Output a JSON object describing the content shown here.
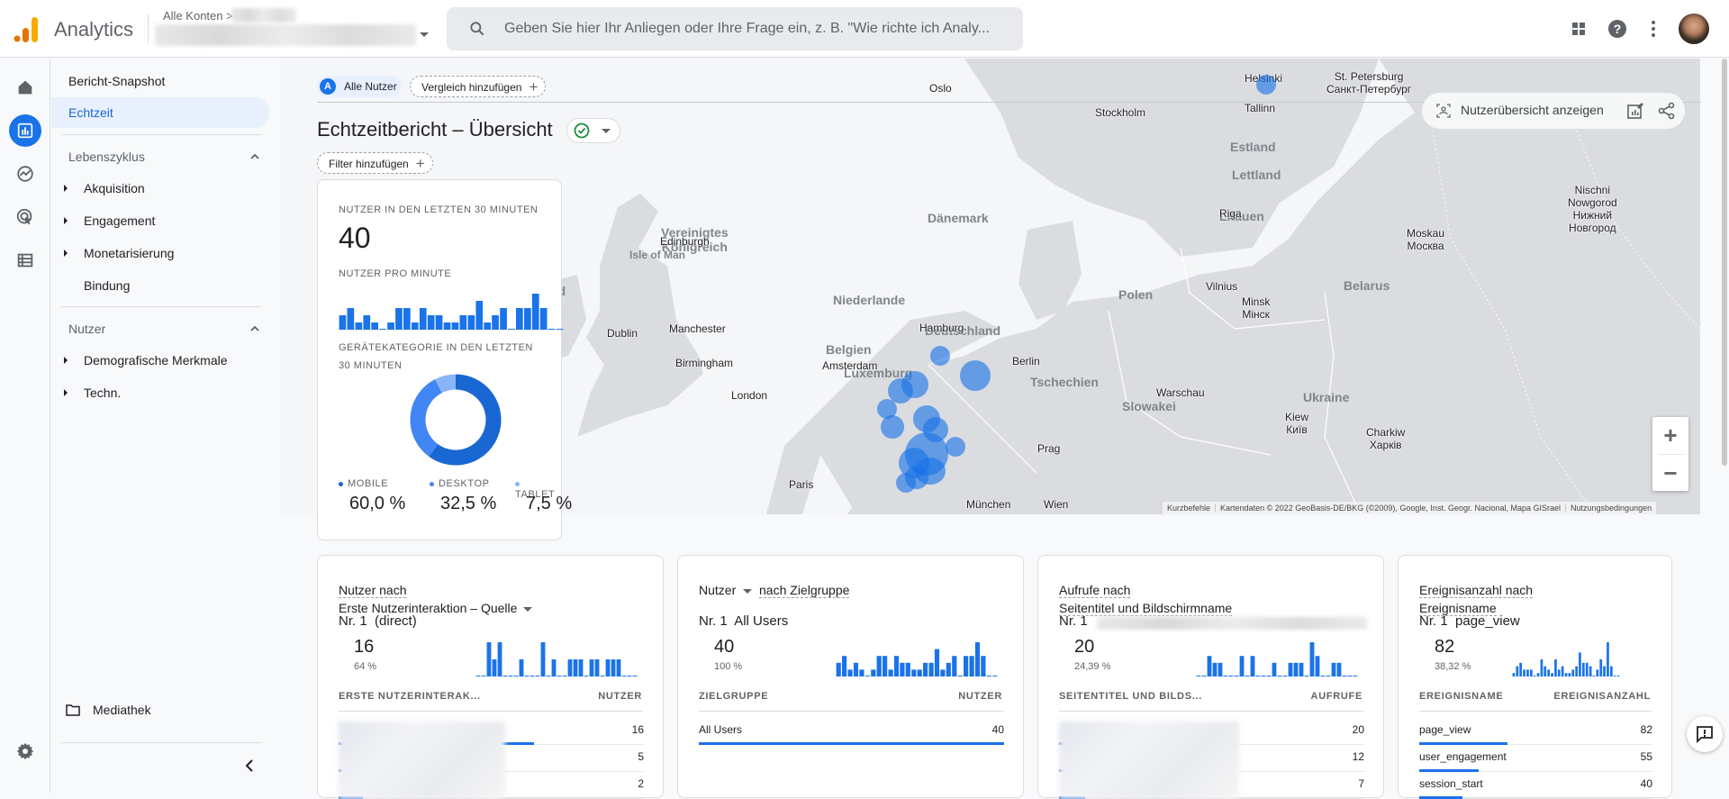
{
  "header": {
    "app_name": "Analytics",
    "account_breadcrumb": "Alle Konten >",
    "search_placeholder": "Geben Sie hier Ihr Anliegen oder Ihre Frage ein, z. B. \"Wie richte ich Analy...",
    "icons": [
      "apps-grid-icon",
      "help-icon",
      "more-vert-icon",
      "avatar"
    ]
  },
  "rail": {
    "items": [
      "home-icon",
      "reports-icon",
      "explore-icon",
      "advertising-icon",
      "configure-icon"
    ],
    "active": "reports-icon",
    "bottom": "settings-gear-icon"
  },
  "nav": {
    "snapshot": "Bericht-Snapshot",
    "realtime": "Echtzeit",
    "section_lifecycle": "Lebenszyklus",
    "lifecycle_items": [
      {
        "label": "Akquisition",
        "expandable": true
      },
      {
        "label": "Engagement",
        "expandable": true
      },
      {
        "label": "Monetarisierung",
        "expandable": true
      },
      {
        "label": "Bindung",
        "expandable": false
      }
    ],
    "section_user": "Nutzer",
    "user_items": [
      {
        "label": "Demografische Merkmale",
        "expandable": true
      },
      {
        "label": "Techn.",
        "expandable": true
      }
    ],
    "library": "Mediathek"
  },
  "toolbar": {
    "segment_badge": "A",
    "segment": "Alle Nutzer",
    "add_comparison": "Vergleich hinzufügen",
    "title": "Echtzeitbericht – Übersicht",
    "add_filter": "Filter hinzufügen",
    "view_user_snapshot": "Nutzerübersicht anzeigen"
  },
  "map": {
    "cities": [
      {
        "name": "Oslo"
      },
      {
        "name": "Stockholm"
      },
      {
        "name": "Helsinki"
      },
      {
        "name": "Tallinn"
      },
      {
        "name": "St. Petersburg\nСанкт-Петербург"
      },
      {
        "name": "Riga"
      },
      {
        "name": "Edinburgh"
      },
      {
        "name": "Dublin"
      },
      {
        "name": "Manchester"
      },
      {
        "name": "Birmingham"
      },
      {
        "name": "London"
      },
      {
        "name": "Amsterdam"
      },
      {
        "name": "Hamburg"
      },
      {
        "name": "Berlin"
      },
      {
        "name": "Paris"
      },
      {
        "name": "Prag"
      },
      {
        "name": "München"
      },
      {
        "name": "Wien"
      },
      {
        "name": "Warschau"
      },
      {
        "name": "Vilnius"
      },
      {
        "name": "Minsk\nМінск"
      },
      {
        "name": "Kiew\nКиїв"
      },
      {
        "name": "Charkiw\nХарків"
      },
      {
        "name": "Moskau\nМосква"
      },
      {
        "name": "Nischni\nNowgorod\nНижний\nНовгород"
      }
    ],
    "countries": [
      "Vereinigtes\nKönigreich",
      "Isle of Man",
      "Irland",
      "Dänemark",
      "Niederlande",
      "Deutschland",
      "Belgien",
      "Luxemburg",
      "Tschechien",
      "Slowakei",
      "Polen",
      "Belarus",
      "Ukraine",
      "Litauen",
      "Lettland",
      "Estland"
    ],
    "zoom_in": "+",
    "zoom_out": "−",
    "attribution": [
      "Kurzbefehle",
      "Kartendaten © 2022 GeoBasis-DE/BKG (©2009), Google, Inst. Geogr. Nacional, Mapa GISrael",
      "Nutzungsbedingungen"
    ]
  },
  "summary": {
    "users_30min_label": "Nutzer in den letzten 30 Minuten",
    "users_30min": "40",
    "per_minute_label": "Nutzer pro Minute",
    "per_minute": [
      2,
      3,
      1,
      2,
      1,
      0,
      1,
      3,
      3,
      1,
      3,
      2,
      2,
      1,
      1,
      2,
      2,
      4,
      1,
      2,
      3,
      0,
      3,
      3,
      5,
      3,
      0,
      0
    ],
    "device_label_1": "Gerätekategorie in den letzten",
    "device_label_2": "30 Minuten",
    "devices": [
      {
        "name": "MOBILE",
        "value": "60,0 %",
        "share": 60.0,
        "color": "#1967d2"
      },
      {
        "name": "DESKTOP",
        "value": "32,5 %",
        "share": 32.5,
        "color": "#4285f4"
      },
      {
        "name": "TABLET",
        "value": "7,5 %",
        "share": 7.5,
        "color": "#8ab4f8"
      }
    ]
  },
  "cards": [
    {
      "title_line1": "Nutzer nach",
      "title_line2": "Erste Nutzerinteraktion – Quelle",
      "top_prefix": "Nr. 1",
      "top_name": "(direct)",
      "top_value": "16",
      "top_pct": "64 %",
      "spark": [
        0,
        0,
        2,
        1,
        2,
        0,
        0,
        0,
        1,
        0,
        0,
        0,
        2,
        0,
        1,
        0,
        0,
        1,
        1,
        1,
        0,
        1,
        1,
        0,
        1,
        1,
        1,
        0,
        0,
        0
      ],
      "col_dim": "ERSTE NUTZERINTERAK...",
      "col_metric": "NUTZER",
      "rows": [
        {
          "name": "",
          "value": "16",
          "share": 0.64
        },
        {
          "name": "",
          "value": "5",
          "share": 0.2
        },
        {
          "name": "",
          "value": "2",
          "share": 0.08
        }
      ]
    },
    {
      "title_metric": "Nutzer",
      "title_rest": "nach Zielgruppe",
      "top_prefix": "Nr. 1",
      "top_name": "All Users",
      "top_value": "40",
      "top_pct": "100 %",
      "spark": [
        2,
        3,
        1,
        2,
        1,
        0,
        1,
        3,
        3,
        1,
        3,
        2,
        2,
        1,
        1,
        2,
        2,
        4,
        1,
        2,
        3,
        0,
        3,
        3,
        5,
        3,
        0,
        0
      ],
      "col_dim": "ZIELGRUPPE",
      "col_metric": "NUTZER",
      "rows": [
        {
          "name": "All Users",
          "value": "40",
          "share": 1.0
        }
      ]
    },
    {
      "title_line1": "Aufrufe nach",
      "title_line2": "Seitentitel und Bildschirmname",
      "top_prefix": "Nr. 1",
      "top_name": "",
      "top_value": "20",
      "top_pct": "24,39 %",
      "spark": [
        0,
        0,
        3,
        2,
        2,
        0,
        0,
        0,
        3,
        0,
        3,
        0,
        0,
        0,
        2,
        0,
        0,
        2,
        2,
        2,
        0,
        5,
        3,
        0,
        0,
        2,
        2,
        0,
        0,
        0
      ],
      "col_dim": "SEITENTITEL UND BILDS...",
      "col_metric": "AUFRUFE",
      "rows": [
        {
          "name": "",
          "value": "20",
          "share": 0.24
        },
        {
          "name": "",
          "value": "12",
          "share": 0.15
        },
        {
          "name": "",
          "value": "7",
          "share": 0.085
        }
      ]
    },
    {
      "title_line1": "Ereignisanzahl nach",
      "title_line2": "Ereignisname",
      "top_prefix": "Nr. 1",
      "top_name": "page_view",
      "top_value": "82",
      "top_pct": "38,32 %",
      "spark": [
        1,
        3,
        4,
        2,
        2,
        2,
        0,
        1,
        5,
        3,
        2,
        1,
        5,
        2,
        3,
        1,
        1,
        2,
        3,
        7,
        4,
        4,
        3,
        0,
        2,
        5,
        3,
        10,
        3,
        0,
        0
      ],
      "col_dim": "EREIGNISNAME",
      "col_metric": "EREIGNISANZAHL",
      "rows": [
        {
          "name": "page_view",
          "value": "82",
          "share": 0.38
        },
        {
          "name": "user_engagement",
          "value": "55",
          "share": 0.255
        },
        {
          "name": "session_start",
          "value": "40",
          "share": 0.185
        }
      ]
    }
  ],
  "colors": {
    "accent": "#1a73e8",
    "selected_bg": "#e8f0fe",
    "ok_green": "#1e8e3e"
  }
}
